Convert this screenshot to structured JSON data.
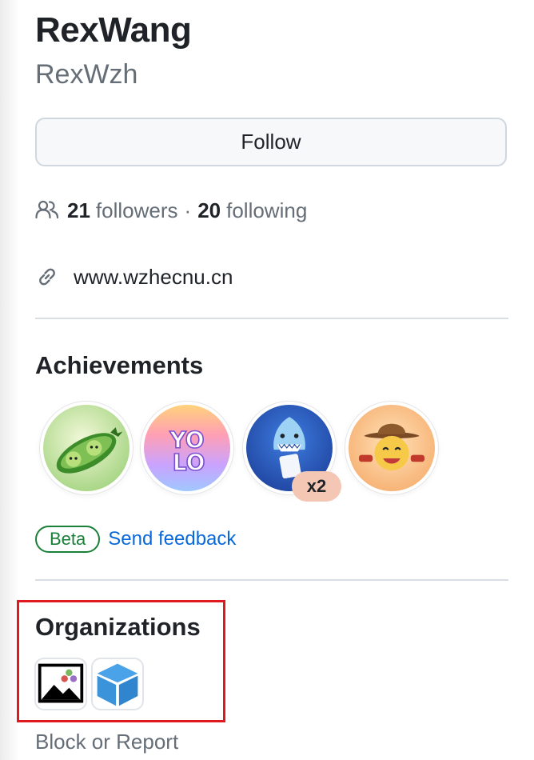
{
  "profile": {
    "name": "RexWang",
    "username": "RexWzh",
    "follow_label": "Follow",
    "followers_count": "21",
    "followers_label": "followers",
    "separator": "·",
    "following_count": "20",
    "following_label": "following",
    "website": "www.wzhecnu.cn"
  },
  "achievements": {
    "title": "Achievements",
    "badges": [
      {
        "name": "pair-extraordinaire-badge"
      },
      {
        "name": "yolo-badge"
      },
      {
        "name": "pull-shark-badge",
        "count": "x2"
      },
      {
        "name": "quickdraw-badge"
      }
    ],
    "beta_label": "Beta",
    "feedback_label": "Send feedback"
  },
  "organizations": {
    "title": "Organizations",
    "items": [
      {
        "name": "image-org-icon"
      },
      {
        "name": "cube-org-icon"
      }
    ]
  },
  "block_report_label": "Block or Report",
  "colors": {
    "text": "#1f2328",
    "muted": "#656d76",
    "link": "#0969da",
    "success": "#1a7f37",
    "highlight": "#e0191f"
  }
}
